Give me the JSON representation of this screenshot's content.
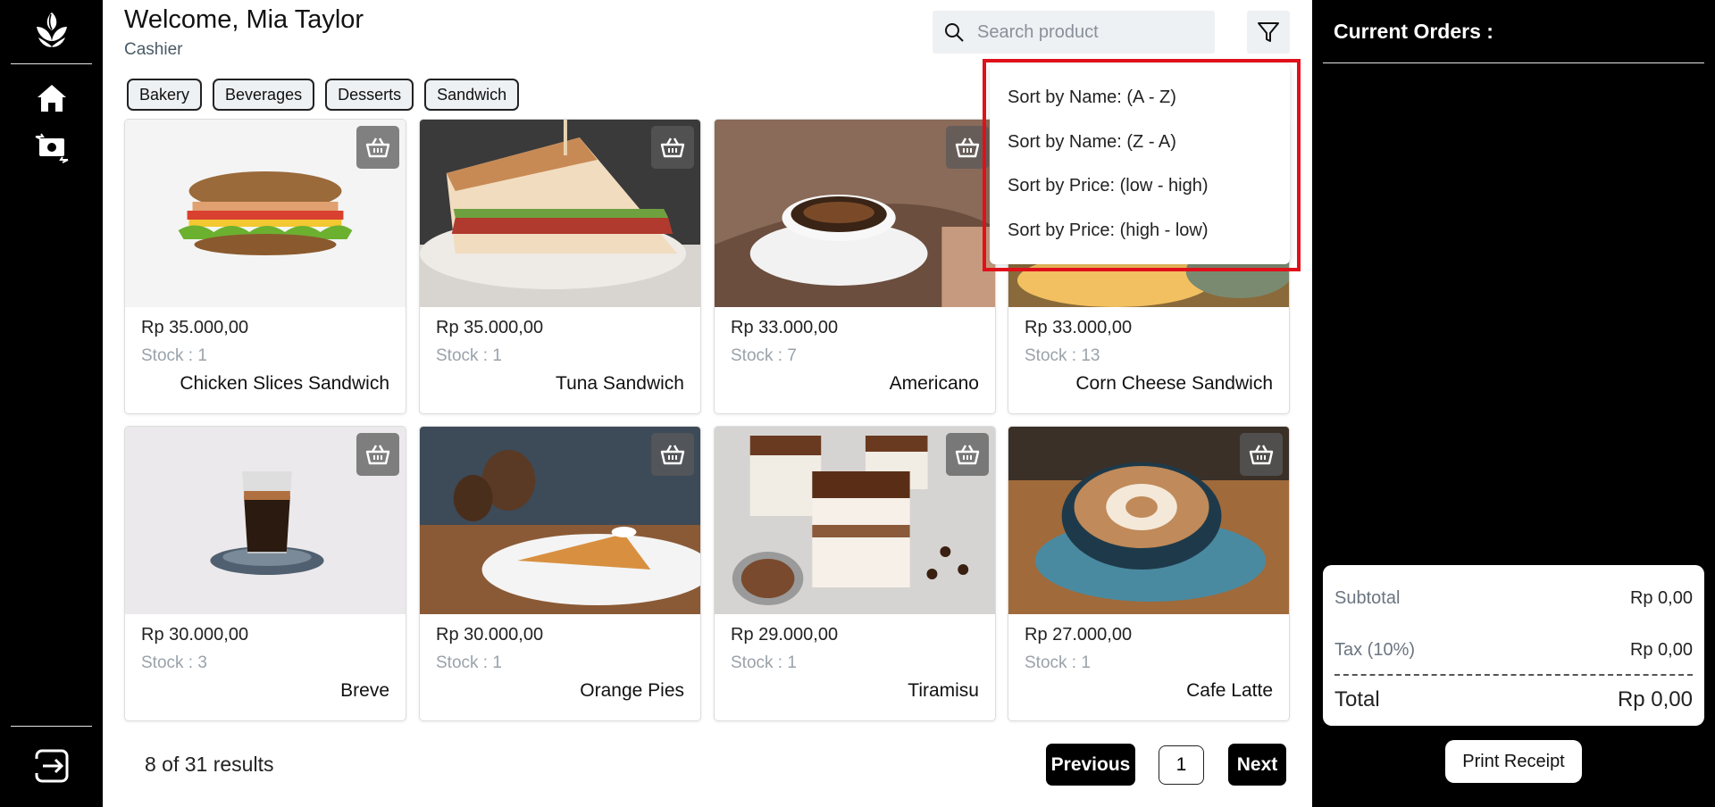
{
  "header": {
    "welcome": "Welcome, Mia Taylor",
    "role": "Cashier"
  },
  "search": {
    "placeholder": "Search product"
  },
  "categories": [
    "Bakery",
    "Beverages",
    "Desserts",
    "Sandwich"
  ],
  "sort_menu": {
    "options": [
      "Sort by Name: (A - Z)",
      "Sort by Name: (Z - A)",
      "Sort by Price: (low - high)",
      "Sort by Price: (high - low)"
    ]
  },
  "products": [
    {
      "price": "Rp 35.000,00",
      "stock": "Stock : 1",
      "name": "Chicken Slices Sandwich"
    },
    {
      "price": "Rp 35.000,00",
      "stock": "Stock : 1",
      "name": "Tuna Sandwich"
    },
    {
      "price": "Rp 33.000,00",
      "stock": "Stock : 7",
      "name": "Americano"
    },
    {
      "price": "Rp 33.000,00",
      "stock": "Stock : 13",
      "name": "Corn Cheese Sandwich"
    },
    {
      "price": "Rp 30.000,00",
      "stock": "Stock : 3",
      "name": "Breve"
    },
    {
      "price": "Rp 30.000,00",
      "stock": "Stock : 1",
      "name": "Orange Pies"
    },
    {
      "price": "Rp 29.000,00",
      "stock": "Stock : 1",
      "name": "Tiramisu"
    },
    {
      "price": "Rp 27.000,00",
      "stock": "Stock : 1",
      "name": "Cafe Latte"
    }
  ],
  "pagination": {
    "results": "8 of 31 results",
    "previous": "Previous",
    "page": "1",
    "next": "Next"
  },
  "orders": {
    "title": "Current Orders :",
    "subtotal_label": "Subtotal",
    "subtotal_value": "Rp 0,00",
    "tax_label": "Tax (10%)",
    "tax_value": "Rp 0,00",
    "total_label": "Total",
    "total_value": "Rp 0,00",
    "print_label": "Print Receipt"
  },
  "colors": {
    "sidebar": "#000000",
    "highlight": "#e0101a",
    "chip_bg": "#eef1f4"
  }
}
